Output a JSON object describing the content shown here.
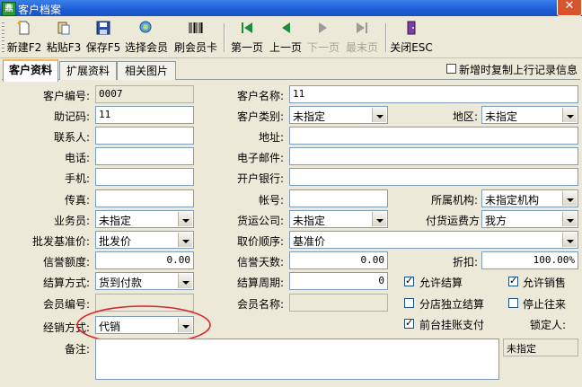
{
  "window": {
    "title": "客户档案",
    "app_icon_text": "鼎",
    "close_glyph": "✕"
  },
  "toolbar": {
    "new": "新建F2",
    "paste": "粘贴F3",
    "save": "保存F5",
    "select_member": "选择会员",
    "swipe_card": "刷会员卡",
    "first": "第一页",
    "prev": "上一页",
    "next": "下一页",
    "last": "最末页",
    "close": "关闭ESC"
  },
  "tabs": [
    "客户资料",
    "扩展资料",
    "相关图片"
  ],
  "copy_prev_row_label": "新增时复制上行记录信息",
  "labels": {
    "cust_code": "客户编号:",
    "cust_name": "客户名称:",
    "mnemonic": "助记码:",
    "cust_type": "客户类别:",
    "region": "地区:",
    "contact": "联系人:",
    "address": "地址:",
    "phone": "电话:",
    "email": "电子邮件:",
    "mobile": "手机:",
    "bank": "开户银行:",
    "fax": "传真:",
    "account": "帐号:",
    "org": "所属机构:",
    "salesman": "业务员:",
    "carrier": "货运公司:",
    "freight": "付货运费方",
    "wholesale_price": "批发基准价:",
    "price_order": "取价顺序:",
    "credit_limit": "信誉额度:",
    "credit_days": "信誉天数:",
    "discount": "折扣:",
    "settle_method": "结算方式:",
    "settle_period": "结算周期:",
    "member_code": "会员编号:",
    "member_name": "会员名称:",
    "dist_method": "经销方式:",
    "notes": "备注:",
    "locker": "锁定人:"
  },
  "values": {
    "cust_code": "0007",
    "cust_name": "11",
    "mnemonic": "11",
    "cust_type": "未指定",
    "region": "未指定",
    "contact": "",
    "address": "",
    "phone": "",
    "email": "",
    "mobile": "",
    "bank": "",
    "fax": "",
    "account": "",
    "org": "未指定机构",
    "salesman": "未指定",
    "carrier": "未指定",
    "freight": "我方",
    "wholesale_price": "批发价",
    "price_order": "基准价",
    "credit_limit": "0.00",
    "credit_days": "0.00",
    "discount": "100.00%",
    "settle_method": "货到付款",
    "settle_period": "0",
    "member_code": "",
    "member_name": "",
    "dist_method": "代销",
    "notes": "",
    "locker": "未指定"
  },
  "checkboxes": {
    "allow_settle": "允许结算",
    "allow_sale": "允许销售",
    "branch_settle": "分店独立结算",
    "stop_dealing": "停止往来",
    "front_hang": "前台挂账支付"
  },
  "colors": {
    "highlight_ellipse": "#d9242a",
    "title_bar": "#1c5cd6",
    "tab_accent": "#f7b84e"
  }
}
